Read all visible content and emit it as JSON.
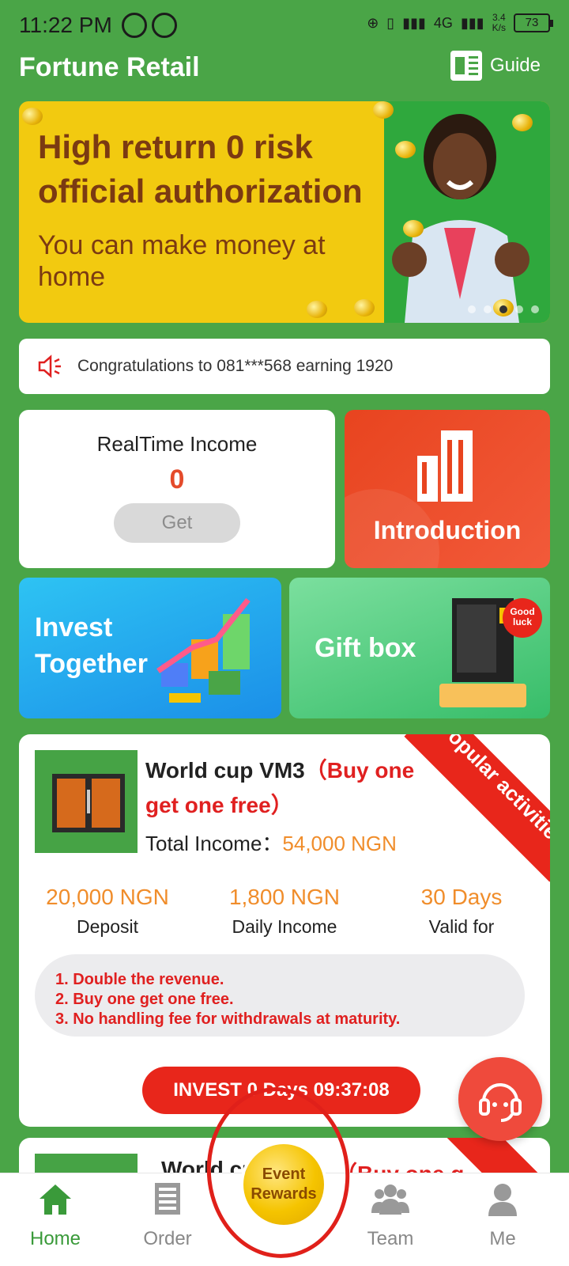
{
  "status_bar": {
    "time": "11:22 PM",
    "network": "4G",
    "speed_value": "3.4",
    "speed_unit": "K/s",
    "battery": "73"
  },
  "header": {
    "title": "Fortune Retail",
    "guide_label": "Guide"
  },
  "banner": {
    "headline_line1": "High return  0 risk",
    "headline_line2": "official authorization",
    "subline": "You can make money at home",
    "slide_count": 5,
    "active_slide": 3
  },
  "notice": {
    "text": "Congratulations to 081***568 earning 1920"
  },
  "income": {
    "title": "RealTime Income",
    "value": "0",
    "button": "Get"
  },
  "tiles": {
    "introduction": "Introduction",
    "invest_line1": "Invest",
    "invest_line2": "Together",
    "gift_box": "Gift box",
    "good_luck": "Good luck"
  },
  "product": {
    "name": "World cup VM3",
    "promo": "（Buy one get one free）",
    "total_income_label": "Total Income：",
    "total_income_value": "54,000 NGN",
    "ribbon": "Popular activities",
    "stats": [
      {
        "value": "20,000 NGN",
        "label": "Deposit"
      },
      {
        "value": "1,800 NGN",
        "label": "Daily Income"
      },
      {
        "value": "30 Days",
        "label": "Valid for"
      }
    ],
    "features": [
      "1. Double the revenue.",
      "2. Buy one get one free.",
      "3. No handling fee for withdrawals at maturity."
    ],
    "invest_button": "INVEST  0  Days 09:37:08"
  },
  "product_2": {
    "name_partial": "World cu",
    "promo_partial": "（Buy one g"
  },
  "event": {
    "line1": "Event",
    "line2": "Rewards"
  },
  "nav": {
    "home": "Home",
    "order": "Order",
    "team": "Team",
    "me": "Me"
  },
  "colors": {
    "background": "#4aa547",
    "accent_red": "#e8261b",
    "accent_orange": "#f08d2b",
    "active_nav": "#3a9a3a"
  }
}
